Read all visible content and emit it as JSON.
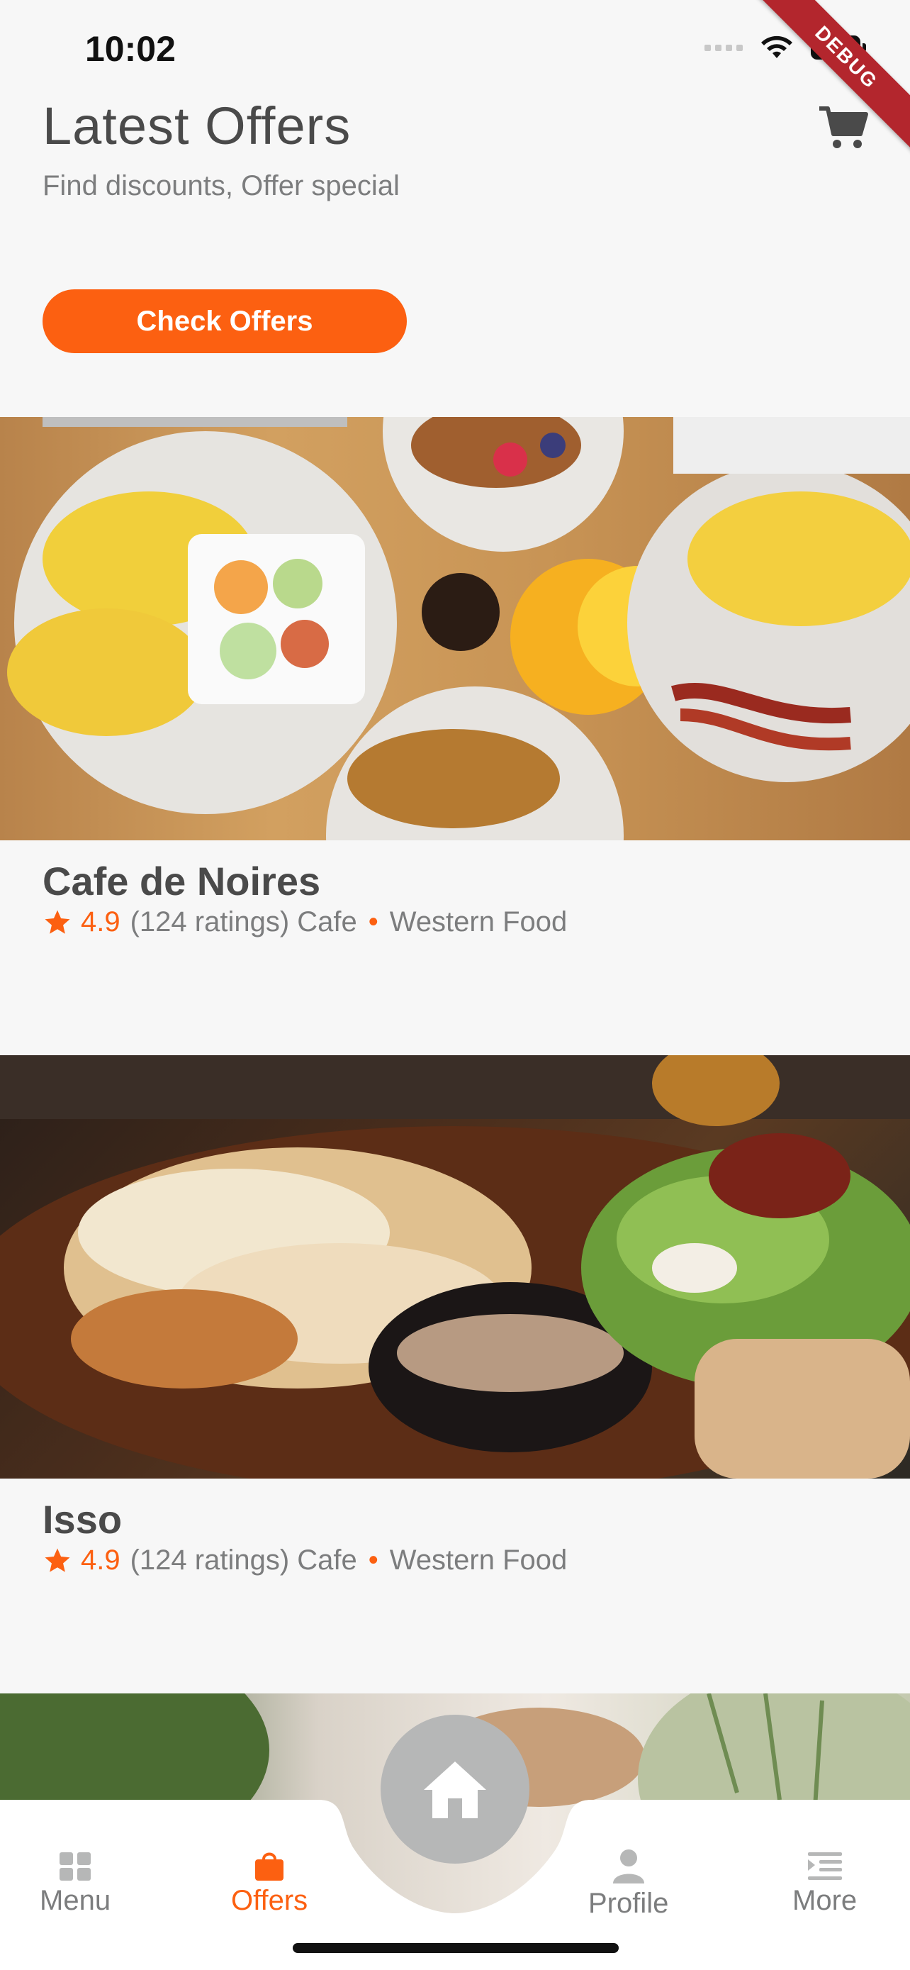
{
  "status_bar": {
    "time": "10:02"
  },
  "debug_banner": "DEBUG",
  "header": {
    "title": "Latest Offers",
    "subtitle": "Find discounts, Offer special",
    "cart_icon": "cart-icon"
  },
  "check_offers_label": "Check Offers",
  "offers": [
    {
      "name": "Cafe de Noires",
      "rating": "4.9",
      "ratings_text": "(124 ratings) Cafe",
      "cuisine": "Western Food"
    },
    {
      "name": "Isso",
      "rating": "4.9",
      "ratings_text": "(124 ratings) Cafe",
      "cuisine": "Western Food"
    }
  ],
  "tab_bar": {
    "items": [
      {
        "label": "Menu",
        "icon": "grid-icon",
        "active": false
      },
      {
        "label": "Offers",
        "icon": "shopping-bag-icon",
        "active": true
      },
      {
        "label": "Profile",
        "icon": "person-icon",
        "active": false
      },
      {
        "label": "More",
        "icon": "list-icon",
        "active": false
      }
    ],
    "home_icon": "home-icon"
  },
  "colors": {
    "accent": "#fc6011",
    "primary_text": "#4a4a4a",
    "secondary_text": "#7c7d7e",
    "background": "#f7f7f7",
    "home_button": "#b6b7b7"
  }
}
